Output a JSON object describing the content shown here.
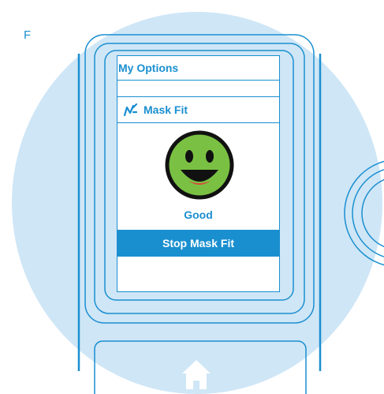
{
  "figure": {
    "letter": "F"
  },
  "screen": {
    "title": "My Options",
    "menu_item": {
      "label": "Mask Fit",
      "icon": "mask-fit-icon"
    },
    "result": {
      "icon": "smiley-face-icon",
      "status": "Good",
      "color": "#7ac143"
    },
    "action_button": {
      "label": "Stop Mask Fit"
    }
  },
  "home": {
    "icon": "home-icon"
  },
  "colors": {
    "accent": "#1a8fd0",
    "background": "#cfe6f6",
    "smiley": "#7ac143"
  }
}
